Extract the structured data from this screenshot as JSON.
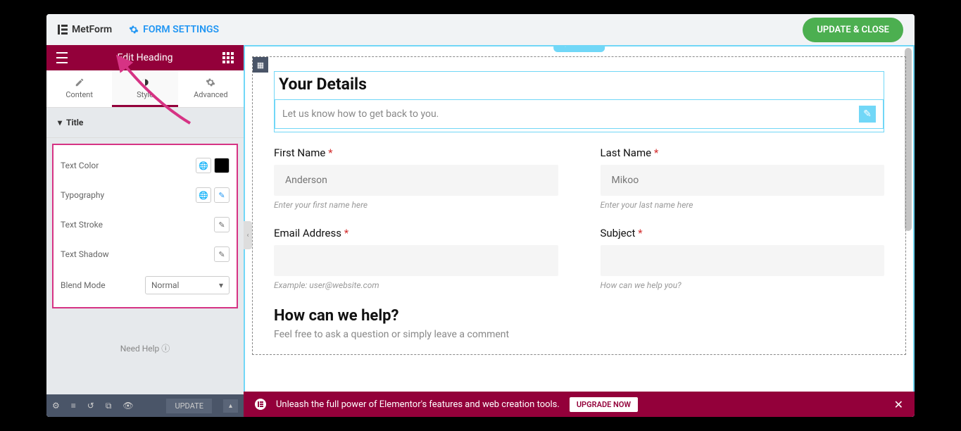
{
  "topbar": {
    "logo": "MetForm",
    "formSettings": "FORM SETTINGS",
    "updateClose": "UPDATE & CLOSE"
  },
  "sidebar": {
    "editTitle": "Edit Heading",
    "tabs": {
      "content": "Content",
      "style": "Style",
      "advanced": "Advanced"
    },
    "section": "Title",
    "controls": {
      "textColor": "Text Color",
      "typography": "Typography",
      "textStroke": "Text Stroke",
      "textShadow": "Text Shadow",
      "blendMode": "Blend Mode",
      "blendModeValue": "Normal"
    },
    "needHelp": "Need Help"
  },
  "bottomToolbar": {
    "update": "UPDATE"
  },
  "canvas": {
    "yourDetails": "Your Details",
    "yourDetailsSub": "Let us know how to get back to you.",
    "firstName": {
      "label": "First Name",
      "placeholder": "Anderson",
      "hint": "Enter your first name here"
    },
    "lastName": {
      "label": "Last Name",
      "placeholder": "Mikoo",
      "hint": "Enter your last name here"
    },
    "email": {
      "label": "Email Address",
      "hint": "Example: user@website.com"
    },
    "subject": {
      "label": "Subject",
      "hint": "How can we help you?"
    },
    "howHelp": "How can we help?",
    "howHelpSub": "Feel free to ask a question or simply leave a comment"
  },
  "promo": {
    "text": "Unleash the full power of Elementor's features and web creation tools.",
    "upgrade": "UPGRADE NOW"
  }
}
